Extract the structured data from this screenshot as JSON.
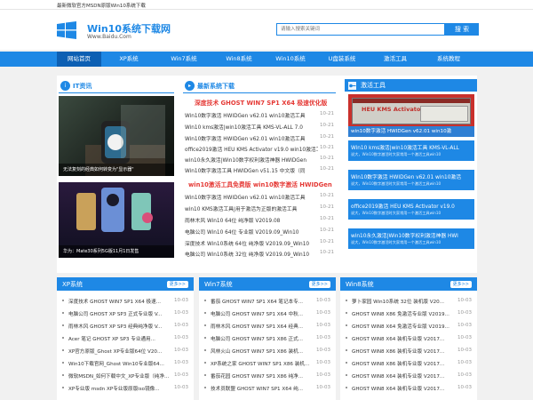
{
  "topbar": {
    "text": "最新微软官方MSDN原版Win10系统下载"
  },
  "logo": {
    "title": "Win10系统下载网",
    "subtitle": "Www.Baidu.Com"
  },
  "search": {
    "placeholder": "请输入搜索关键词",
    "button": "搜 索"
  },
  "nav": [
    "网站首页",
    "XP系统",
    "Win7系统",
    "Win8系统",
    "Win10系统",
    "U盘装系统",
    "激活工具",
    "系统教程"
  ],
  "it_news": {
    "title": "IT资讯",
    "caption1": "无法复刻的经典如何转变为\"显示器\"",
    "caption2": "华为：Mate30系列5G版11月1日发售"
  },
  "latest": {
    "title": "最新系统下载",
    "headline1": "深度技术 GHOST WIN7 SP1 X64 极速优化版",
    "group1": [
      {
        "t": "Win10数字激活 HWIDGen v62.01 win10激活工具",
        "d": "10-21"
      },
      {
        "t": "Win10 kms激活|win10激活工具 KMS-VL-ALL 7.0",
        "d": "10-21"
      },
      {
        "t": "Win10数字激活 HWIDGen v62.01 win10激活工具",
        "d": "10-21"
      },
      {
        "t": "office2019激活 HEU KMS Activator v19.0 win10激活工具",
        "d": "10-21"
      },
      {
        "t": "win10永久激活|Win10数字权利激活神器 HWIDGen",
        "d": "10-21"
      },
      {
        "t": "Win10数字激活工具 HWIDGen v51.15 中文版（同",
        "d": "10-21"
      }
    ],
    "headline2": "win10激活工具免费版 win10数字激活 HWIDGen",
    "group2": [
      {
        "t": "Win10数字激活 HWIDGen v62.01 win10激活工具",
        "d": "10-21"
      },
      {
        "t": "win10 KMS激活工具|用于激活为正版的激活工具",
        "d": "10-21"
      },
      {
        "t": "雨林木风 Win10 64位 纯净版 V2019.08",
        "d": "10-21"
      },
      {
        "t": "电脑公司 Win10 64位 专业版 V2019.09_Win10",
        "d": "10-21"
      },
      {
        "t": "深度技术 Win10系统 64位 纯净版 V2019.09_Win10",
        "d": "10-21"
      },
      {
        "t": "电脑公司 Win10系统 32位 纯净版 V2019.09_Win10",
        "d": "10-21"
      }
    ]
  },
  "activation": {
    "title": "激活工具",
    "image_text": "HEU KMS Activator",
    "image_label": "win10数字激活 HWIDGen v62.01 win10激",
    "items": [
      {
        "title": "Win10 kms激活|win10激活工具 KMS-VL-ALL",
        "desc": "说大，Win10数字激活时大家常用一个激活工具win10"
      },
      {
        "title": "Win10数字激活 HWIDGen v62.01 win10激活",
        "desc": "说大，Win10数字激活时大家常用一个激活工具win10"
      },
      {
        "title": "office2019激活 HEU KMS Activator v19.0",
        "desc": "说大，Win10数字激活时大家常用一个激活工具win10"
      },
      {
        "title": "win10永久激活|Win10数字权利激活神器 HWI",
        "desc": "说大，Win10数字激活时大家常用一个激活工具win10"
      }
    ]
  },
  "xp": {
    "title": "XP系统",
    "more": "更多>>",
    "items": [
      {
        "t": "深度技术 GHOST WIN7 SP1 X64 极速...",
        "d": "10-03"
      },
      {
        "t": "电脑公司 GHOST XP SP3 正式专业版 V...",
        "d": "10-03"
      },
      {
        "t": "雨林木风 GHOST XP SP3 经典纯净版 V...",
        "d": "10-03"
      },
      {
        "t": "Acer 笔记 GHOST XP SP3 专业通用...",
        "d": "10-03"
      },
      {
        "t": "XP官方原版_Ghost XP专业版64位 V20...",
        "d": "10-03"
      },
      {
        "t": "Win10下载官网_Ghost Win10专业版64...",
        "d": "10-03"
      },
      {
        "t": "微软MSDN_如何下载中文_XP专业版（纯净...",
        "d": "10-03"
      },
      {
        "t": "XP专业版 msdn XP专业版原版iso镜像...",
        "d": "10-03"
      }
    ]
  },
  "win7": {
    "title": "Win7系统",
    "more": "更多>>",
    "items": [
      {
        "t": "番茄 GHOST WIN7 SP1 X64 笔记本专...",
        "d": "10-03"
      },
      {
        "t": "电脑公司 GHOST WIN7 SP1 X64 中秋...",
        "d": "10-03"
      },
      {
        "t": "雨林木风 GHOST WIN7 SP1 X64 经典...",
        "d": "10-03"
      },
      {
        "t": "电脑公司 GHOST WIN7 SP1 X86 正式...",
        "d": "10-03"
      },
      {
        "t": "风林火山 GHOST WIN7 SP1 X86 装机...",
        "d": "10-03"
      },
      {
        "t": "XP系统之家 GHOST WIN7 SP1 X86 装机...",
        "d": "10-03"
      },
      {
        "t": "番茄花园 GHOST WIN7 SP1 X86 纯净...",
        "d": "10-03"
      },
      {
        "t": "技术员联盟 GHOST WIN7 SP1 X64 纯...",
        "d": "10-03"
      }
    ]
  },
  "win8": {
    "title": "Win8系统",
    "more": "更多>>",
    "items": [
      {
        "t": "萝卜家园 Win10系统 32位 装机版 V20...",
        "d": "10-03"
      },
      {
        "t": "GHOST WIN8 X86 免激活专业版 V2019...",
        "d": "10-03"
      },
      {
        "t": "GHOST WIN8 X64 免激活专业版 V2019...",
        "d": "10-03"
      },
      {
        "t": "GHOST WIN8 X64 装机专业版 V2017...",
        "d": "10-03"
      },
      {
        "t": "GHOST WIN8 X86 装机专业版 V2017...",
        "d": "10-03"
      },
      {
        "t": "GHOST WIN8 X86 装机专业版 V2017...",
        "d": "10-03"
      },
      {
        "t": "GHOST WIN8 X64 装机专业版 V2017...",
        "d": "10-03"
      },
      {
        "t": "GHOST WIN8 X64 装机专业版 V2017...",
        "d": "10-03"
      }
    ]
  }
}
